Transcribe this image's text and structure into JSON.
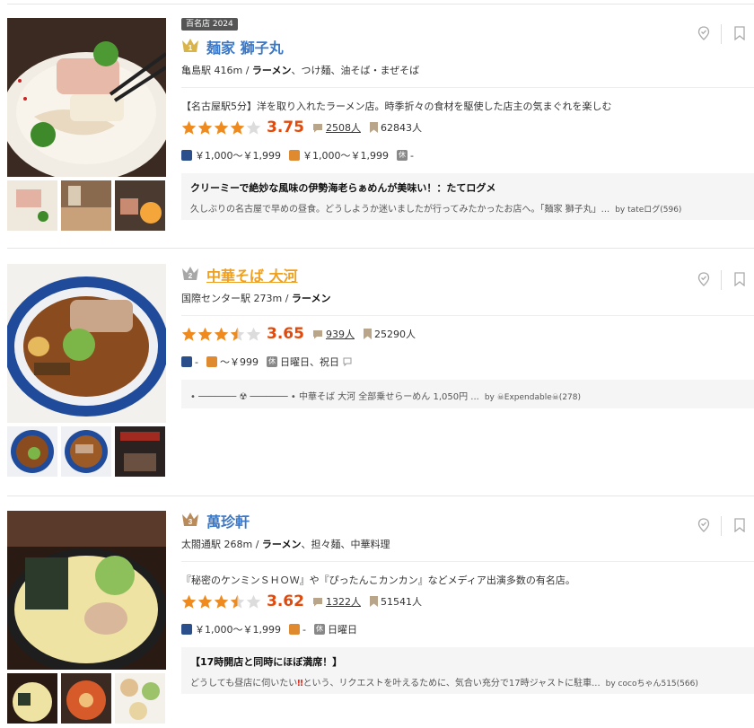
{
  "restaurants": [
    {
      "badge": "百名店 2024",
      "rank": "1",
      "name": "麺家 獅子丸",
      "station_distance": "亀島駅 416m / ",
      "genre_main": "ラーメン",
      "genre_rest": "、つけ麺、油そば・まぜそば",
      "pr": "【名古屋駅5分】洋を取り入れたラーメン店。時季折々の食材を駆使した店主の気まぐれを楽しむ",
      "rating": "3.75",
      "rating_value": 3.75,
      "reviews": "2508人",
      "bookmarks": "62843人",
      "dinner_price": "￥1,000～￥1,999",
      "lunch_price": "￥1,000～￥1,999",
      "closed_label": "休",
      "closed": "-",
      "review_title": "クリーミーで絶妙な風味の伊勢海老らぁめんが美味い！：たてログメ",
      "review_body": "久しぶりの名古屋で早めの昼食。どうしようか迷いましたが行ってみたかったお店へ。「麺家 獅子丸」...",
      "review_by": "by tateログ(596)"
    },
    {
      "rank": "2",
      "name": "中華そば 大河",
      "station_distance": "国際センター駅 273m / ",
      "genre_main": "ラーメン",
      "genre_rest": "",
      "rating": "3.65",
      "rating_value": 3.65,
      "reviews": "939人",
      "bookmarks": "25290人",
      "dinner_price": "-",
      "lunch_price": "～￥999",
      "closed_label": "休",
      "closed": "日曜日、祝日",
      "review_body": "• ─────── ☢ ─────── • 中華そば 大河 全部乗せらーめん 1,050円 ...",
      "review_by": "by ☠Expendable☠(278)"
    },
    {
      "rank": "3",
      "name": "萬珍軒",
      "station_distance": "太閤通駅 268m / ",
      "genre_main": "ラーメン",
      "genre_rest": "、担々麺、中華料理",
      "pr": "『秘密のケンミンＳＨＯＷ』や『ぴったんこカンカン』などメディア出演多数の有名店。",
      "rating": "3.62",
      "rating_value": 3.62,
      "reviews": "1322人",
      "bookmarks": "51541人",
      "dinner_price": "￥1,000～￥1,999",
      "lunch_price": "-",
      "closed_label": "休",
      "closed": "日曜日",
      "review_title": "【17時開店と同時にほぼ満席！】",
      "review_body_pre": "どうしても昼店に伺いたい",
      "review_body_bang": "‼",
      "review_body_post": "という、リクエストを叶えるために、気合い充分で17時ジャストに駐車...",
      "review_by": "by cocoちゃん515(566)"
    }
  ],
  "colors": {
    "link_blue": "#3a78c9",
    "link_orange": "#f0a020",
    "score_red": "#e04a0c",
    "star_orange": "#f08a1c"
  },
  "icons": {
    "pin": "map-pin-check-icon",
    "bookmark": "bookmark-icon",
    "comment": "comment-bubble-icon",
    "saved": "bookmark-ribbon-icon"
  }
}
